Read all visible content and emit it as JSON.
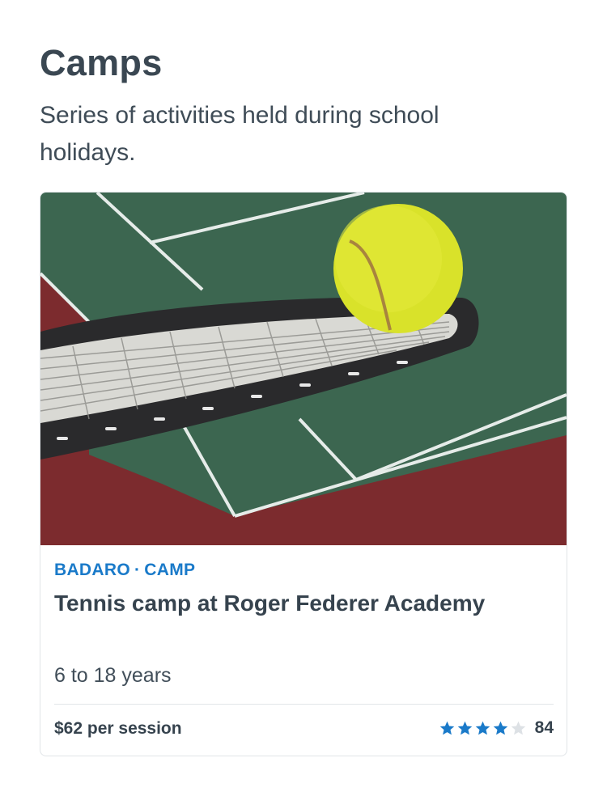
{
  "section": {
    "title": "Camps",
    "subtitle": "Series of activities held during school holidays."
  },
  "card": {
    "image_alt": "Tennis ball on a tennis racket on a court",
    "location": "BADARO",
    "separator": "·",
    "category": "CAMP",
    "title": "Tennis camp at Roger Federer Academy",
    "age_range": "6 to 18 years",
    "price": "$62 per session",
    "rating": {
      "stars_filled": 4,
      "stars_total": 5,
      "count": "84"
    }
  },
  "colors": {
    "accent": "#1a7ac9",
    "star_filled": "#1a7ac9",
    "star_empty": "#dde1e5",
    "court_green": "#3c6650",
    "court_red": "#7c2b2e"
  }
}
